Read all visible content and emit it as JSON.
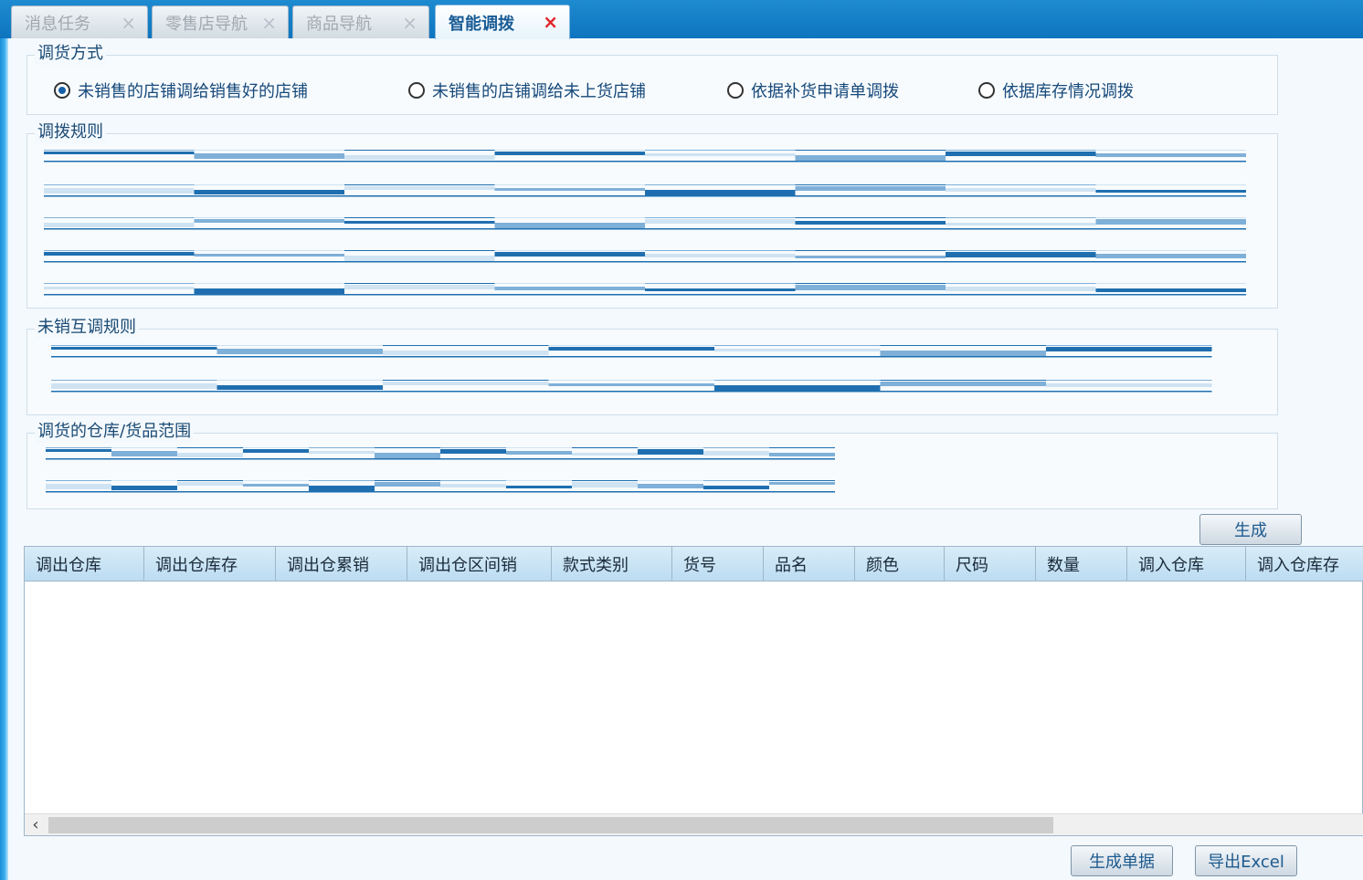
{
  "tabs": [
    {
      "label": "消息任务",
      "close": "×",
      "active": false
    },
    {
      "label": "零售店导航",
      "close": "×",
      "active": false
    },
    {
      "label": "商品导航",
      "close": "×",
      "active": false
    },
    {
      "label": "智能调拨",
      "close": "×",
      "active": true
    }
  ],
  "transfer_mode": {
    "legend": "调货方式",
    "options": [
      {
        "label": "未销售的店铺调给销售好的店铺",
        "checked": true
      },
      {
        "label": "未销售的店铺调给未上货店铺",
        "checked": false
      },
      {
        "label": "依据补货申请单调拨",
        "checked": false
      },
      {
        "label": "依据库存情况调拨",
        "checked": false
      }
    ]
  },
  "rules": {
    "legend": "调拨规则"
  },
  "unsold_rules": {
    "legend": "未销互调规则"
  },
  "range": {
    "legend": "调货的仓库/货品范围"
  },
  "buttons": {
    "generate": "生成",
    "generate_doc": "生成单据",
    "export_excel": "导出Excel"
  },
  "grid": {
    "columns": [
      "调出仓库",
      "调出仓库存",
      "调出仓累销",
      "调出仓区间销",
      "款式类别",
      "货号",
      "品名",
      "颜色",
      "尺码",
      "数量",
      "调入仓库",
      "调入仓库存"
    ],
    "rows": []
  },
  "colors": {
    "accent": "#1878c8",
    "band_dark": "#1f6fb0",
    "band_mid": "#7fb0d8",
    "band_light": "#cfe3f2"
  },
  "icons": {
    "tab_close": "close-icon",
    "scroll_left": "chevron-left-icon"
  }
}
